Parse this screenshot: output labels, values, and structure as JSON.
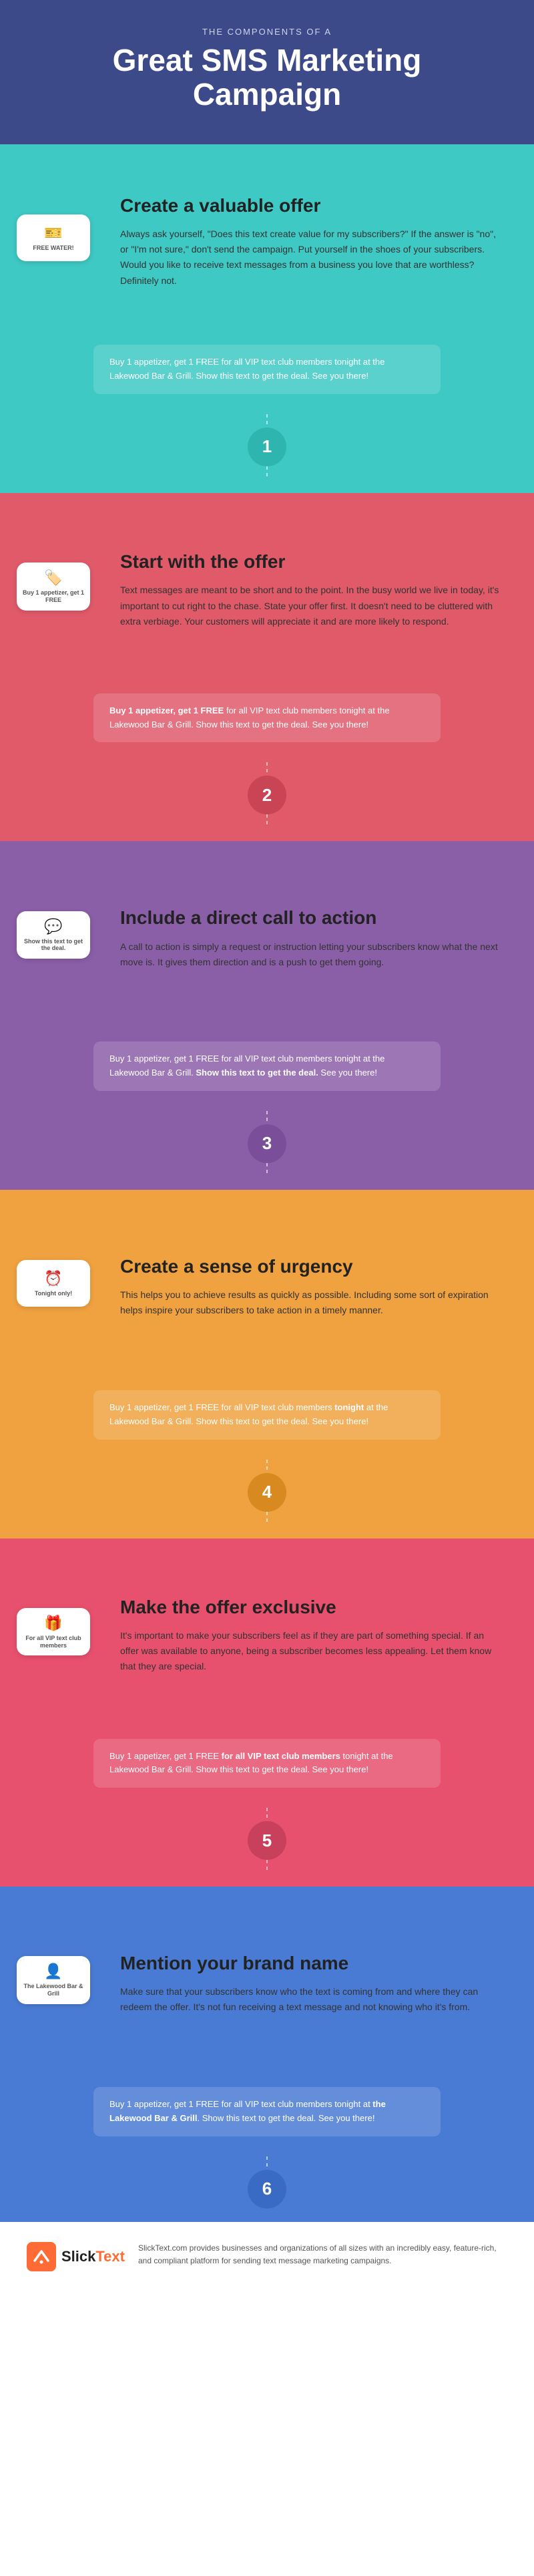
{
  "header": {
    "subtitle": "The Components of a",
    "title": "Great SMS Marketing Campaign"
  },
  "tips": [
    {
      "id": 1,
      "theme": "teal",
      "numberClass": "number-teal",
      "bgClass": "theme-teal",
      "heading": "Create a valuable offer",
      "body": "Always ask yourself, \"Does this text create value for my subscribers?\" If the answer is \"no\", or \"I'm not sure,\" don't send the campaign. Put yourself in the shoes of your subscribers. Would you like to receive text messages from a business you love that are worthless? Definitely not.",
      "phoneLabel": "FREE WATER!",
      "phoneIcon": "🎫",
      "sms": {
        "text": "Buy 1 appetizer, get 1 FREE for all VIP text club members tonight at the Lakewood Bar & Grill. Show this text to get the deal. See you there!",
        "boldParts": []
      }
    },
    {
      "id": 2,
      "theme": "red",
      "numberClass": "number-red",
      "bgClass": "theme-red",
      "heading": "Start with the offer",
      "body": "Text messages are meant to be short and to the point. In the busy world we live in today, it's important to cut right to the chase. State your offer first. It doesn't need to be cluttered with extra verbiage. Your customers will appreciate it and are more likely to respond.",
      "phoneLabel": "Buy 1 appetizer, get 1 FREE",
      "phoneIcon": "🏷️",
      "sms": {
        "text": "Buy 1 appetizer, get 1 FREE for all VIP text club members tonight at the Lakewood Bar & Grill. Show this text to get the deal. See you there!",
        "boldParts": [
          "Buy 1 appetizer, get 1 FREE"
        ]
      }
    },
    {
      "id": 3,
      "theme": "purple",
      "numberClass": "number-purple",
      "bgClass": "theme-purple",
      "heading": "Include a direct call to action",
      "body": "A call to action is simply a request or instruction letting your subscribers know what the next move is. It gives them direction and is a push to get them going.",
      "phoneLabel": "Show this text to get the deal.",
      "phoneIcon": "💬",
      "sms": {
        "text": "Buy 1 appetizer, get 1 FREE for all VIP text club members tonight at the Lakewood Bar & Grill. Show this text to get the deal. See you there!",
        "boldParts": [
          "Show this text to get the deal."
        ]
      }
    },
    {
      "id": 4,
      "theme": "orange",
      "numberClass": "number-orange",
      "bgClass": "theme-orange",
      "heading": "Create a sense of urgency",
      "body": "This helps you to achieve results as quickly as possible. Including some sort of expiration helps inspire your subscribers to take action in a timely manner.",
      "phoneLabel": "Tonight only!",
      "phoneIcon": "⏰",
      "sms": {
        "text": "Buy 1 appetizer, get 1 FREE for all VIP text club members tonight at the Lakewood Bar & Grill. Show this text to get the deal. See you there!",
        "boldParts": [
          "tonight"
        ]
      }
    },
    {
      "id": 5,
      "theme": "pink",
      "numberClass": "number-pink",
      "bgClass": "theme-pink",
      "heading": "Make the offer exclusive",
      "body": "It's important to make your subscribers feel as if they are part of something special. If an offer was available to anyone, being a subscriber becomes less appealing. Let them know that they are special.",
      "phoneLabel": "For all VIP text club members",
      "phoneIcon": "🎁",
      "sms": {
        "text": "Buy 1 appetizer, get 1 FREE for all VIP text club members tonight at the Lakewood Bar & Grill. Show this text to get the deal. See you there!",
        "boldParts": [
          "for all VIP text club members"
        ]
      }
    },
    {
      "id": 6,
      "theme": "blue",
      "numberClass": "number-blue",
      "bgClass": "theme-blue",
      "heading": "Mention your brand name",
      "body": "Make sure that your subscribers know who the text is coming from and where they can redeem the offer. It's not fun receiving a text message and not knowing who it's from.",
      "phoneLabel": "The Lakewood Bar & Grill",
      "phoneIcon": "👤",
      "sms": {
        "text": "Buy 1 appetizer, get 1 FREE for all VIP text club members tonight at the Lakewood Bar & Grill. Show this text to get the deal. See you there!",
        "boldParts": [
          "the Lakewood Bar & Grill"
        ]
      }
    }
  ],
  "footer": {
    "logo_text": "SlickText",
    "description": "SlickText.com provides businesses and organizations of all sizes with an incredibly easy, feature-rich, and compliant platform for sending text message marketing campaigns."
  }
}
